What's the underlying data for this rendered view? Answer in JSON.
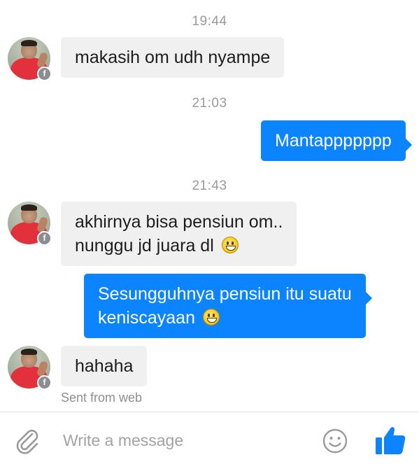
{
  "thread": {
    "timestamps": [
      "19:44",
      "21:03",
      "21:43"
    ],
    "messages": [
      {
        "direction": "incoming",
        "lines": [
          "makasih om udh nyampe"
        ]
      },
      {
        "direction": "outgoing",
        "lines": [
          "Mantappppppp"
        ]
      },
      {
        "direction": "incoming",
        "lines": [
          "akhirnya bisa pensiun om..",
          "nunggu jd juara dl"
        ],
        "emoji": "grinning-face-emoji"
      },
      {
        "direction": "outgoing",
        "lines": [
          "Sesungguhnya pensiun itu suatu",
          "keniscayaan"
        ],
        "emoji": "grinning-face-emoji"
      },
      {
        "direction": "incoming",
        "lines": [
          "hahaha"
        ]
      }
    ],
    "sent_from": "Sent from web"
  },
  "composer": {
    "placeholder": "Write a message",
    "icons": [
      "paperclip-icon",
      "smiley-icon",
      "thumbs-up-icon"
    ]
  },
  "colors": {
    "outgoing_bubble": "#0c84ff",
    "incoming_bubble": "#f1f0f0",
    "like_button": "#0c84ff",
    "timestamp": "#9a9a9a"
  }
}
